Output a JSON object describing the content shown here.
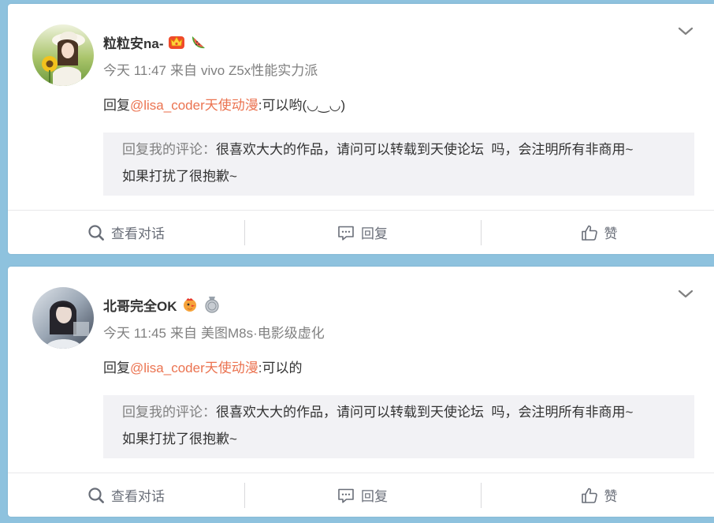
{
  "colors": {
    "page_background": "#8ec2de",
    "card_background": "#ffffff",
    "link": "#eb7350",
    "text": "#333333",
    "meta": "#808080",
    "quote_background": "#f2f2f5",
    "action_text": "#696e78"
  },
  "comments": [
    {
      "username": "粒粒安na-",
      "badges": [
        "vip-crown-badge-icon",
        "watermelon-icon"
      ],
      "time": "今天 11:47",
      "from_label": "来自",
      "source": "vivo Z5x性能实力派",
      "reply": {
        "prefix": "回复",
        "mention": "@lisa_coder天使动漫",
        "text": ":可以哟(◡‿◡)"
      },
      "quote": {
        "label": "回复我的评论：",
        "lines": [
          "很喜欢大大的作品，请问可以转载到天使论坛  吗，会注明所有非商用~",
          "如果打扰了很抱歉~"
        ]
      },
      "actions": {
        "view": "查看对话",
        "reply": "回复",
        "like": "赞"
      }
    },
    {
      "username": "北哥完全OK",
      "badges": [
        "rooster-badge-icon",
        "silver-medal-icon"
      ],
      "time": "今天 11:45",
      "from_label": "来自",
      "source": "美图M8s·电影级虚化",
      "reply": {
        "prefix": "回复",
        "mention": "@lisa_coder天使动漫",
        "text": ":可以的"
      },
      "quote": {
        "label": "回复我的评论：",
        "lines": [
          "很喜欢大大的作品，请问可以转载到天使论坛  吗，会注明所有非商用~",
          "如果打扰了很抱歉~"
        ]
      },
      "actions": {
        "view": "查看对话",
        "reply": "回复",
        "like": "赞"
      }
    }
  ]
}
